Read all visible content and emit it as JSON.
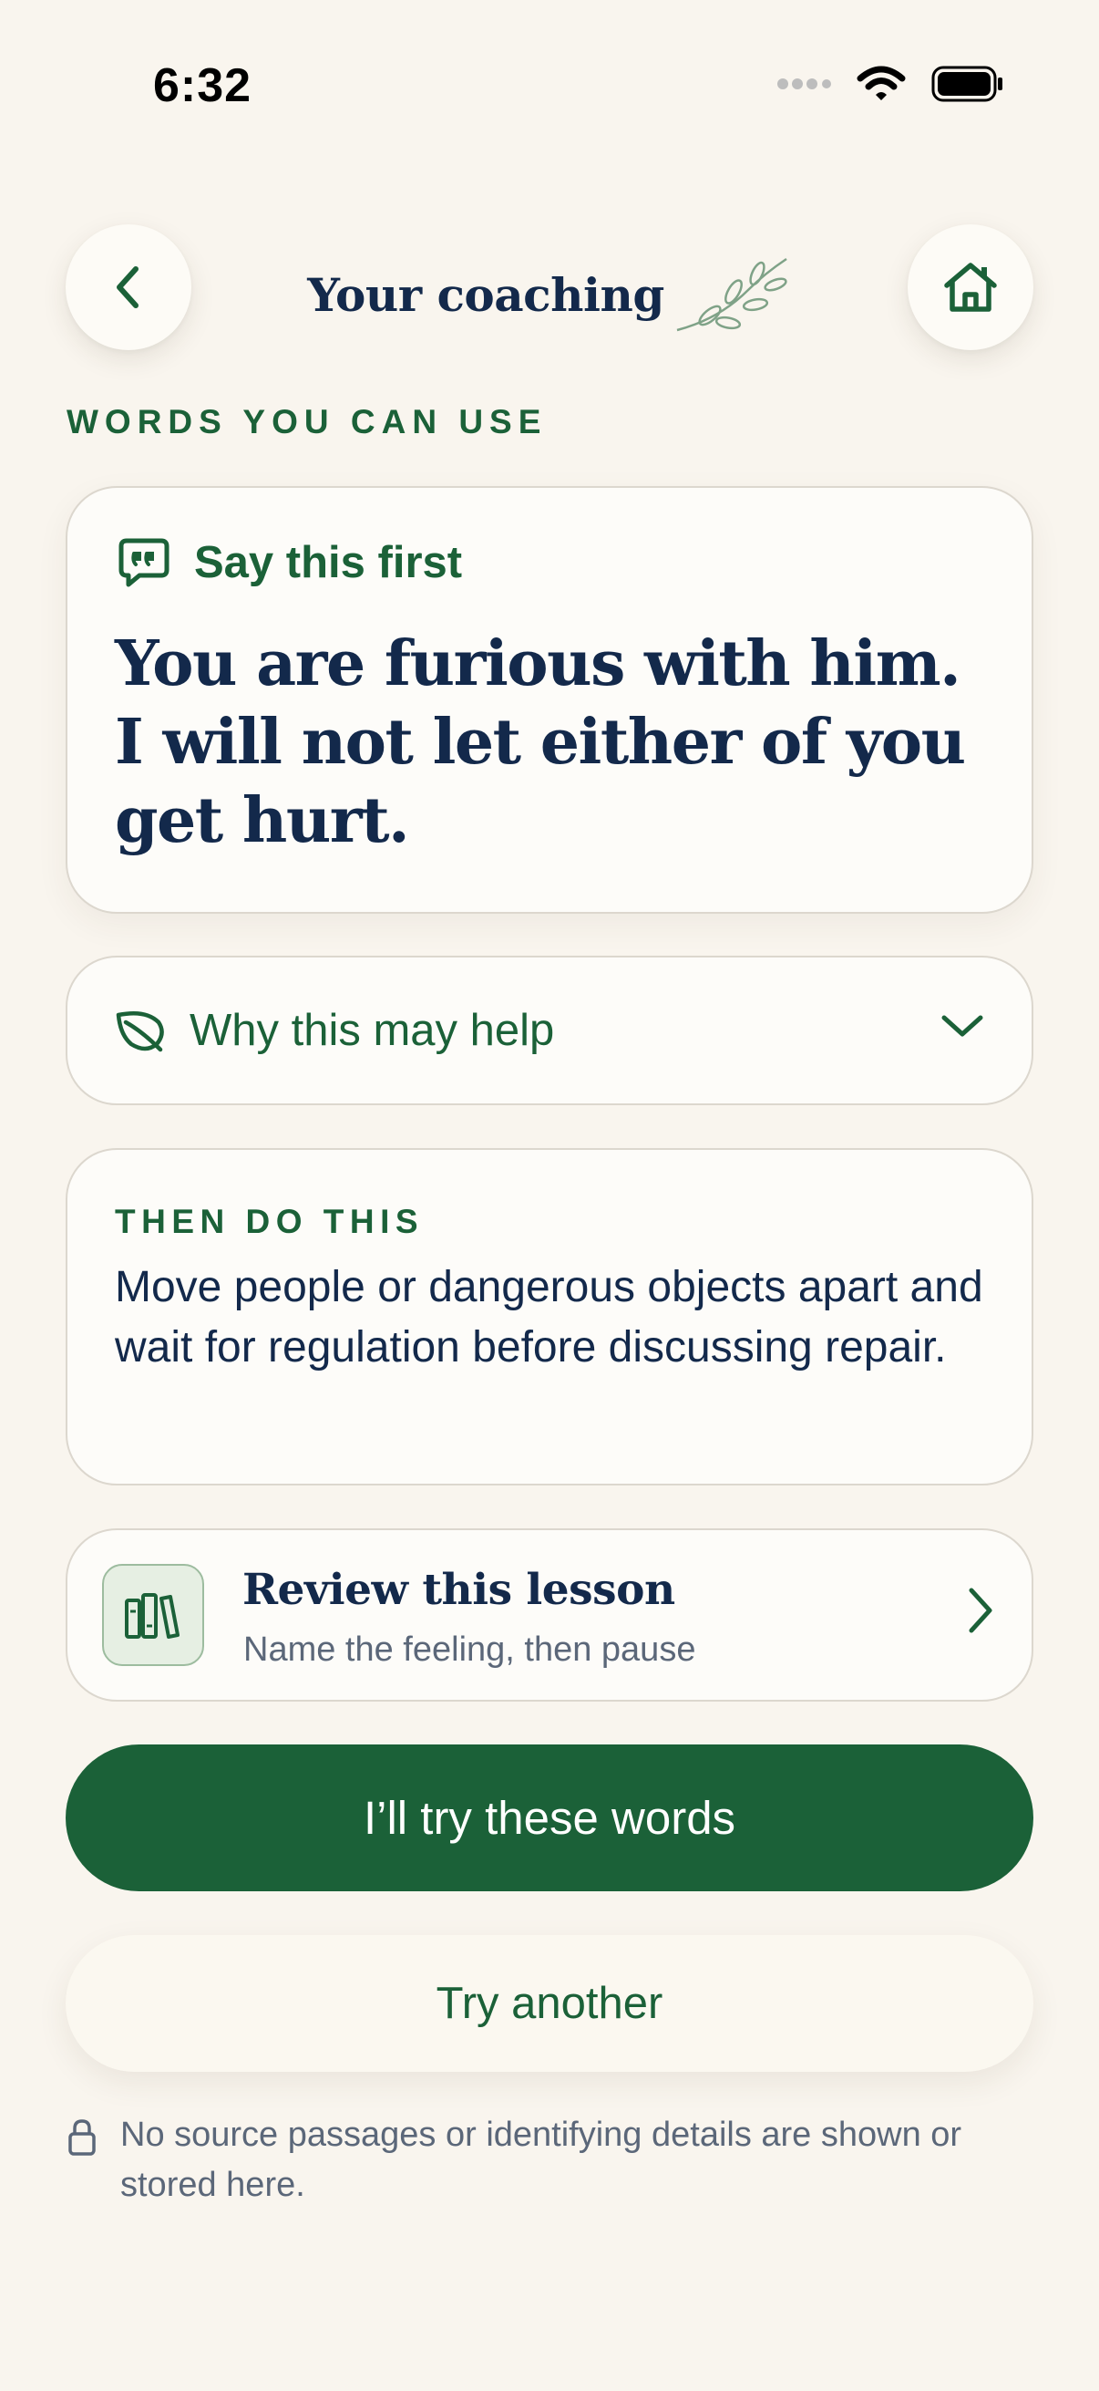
{
  "status_bar": {
    "time": "6:32"
  },
  "header": {
    "title": "Your coaching",
    "back_icon": "chevron-left-icon",
    "home_icon": "home-icon",
    "decor_icon": "sprig-icon"
  },
  "section_label": "WORDS YOU CAN USE",
  "say_card": {
    "label": "Say this first",
    "icon": "speech-bubble-quote-icon",
    "text": "You are furious with him. I will not let either of you get hurt."
  },
  "why_card": {
    "label": "Why this may help",
    "icon": "leaf-icon",
    "expanded": false
  },
  "then_card": {
    "label": "THEN DO THIS",
    "text": "Move people or dangerous objects apart and wait for regulation before discussing repair."
  },
  "review_card": {
    "title": "Review this lesson",
    "subtitle": "Name the feeling, then pause",
    "icon": "books-icon"
  },
  "primary_button": "I’ll try these words",
  "secondary_button": "Try another",
  "privacy_note": "No source passages or identifying details are shown or stored here.",
  "colors": {
    "background": "#f9f5ee",
    "accent_green": "#1b6138",
    "navy_text": "#13294b",
    "muted_text": "#5b6779",
    "card_border": "#dcd7ce"
  }
}
